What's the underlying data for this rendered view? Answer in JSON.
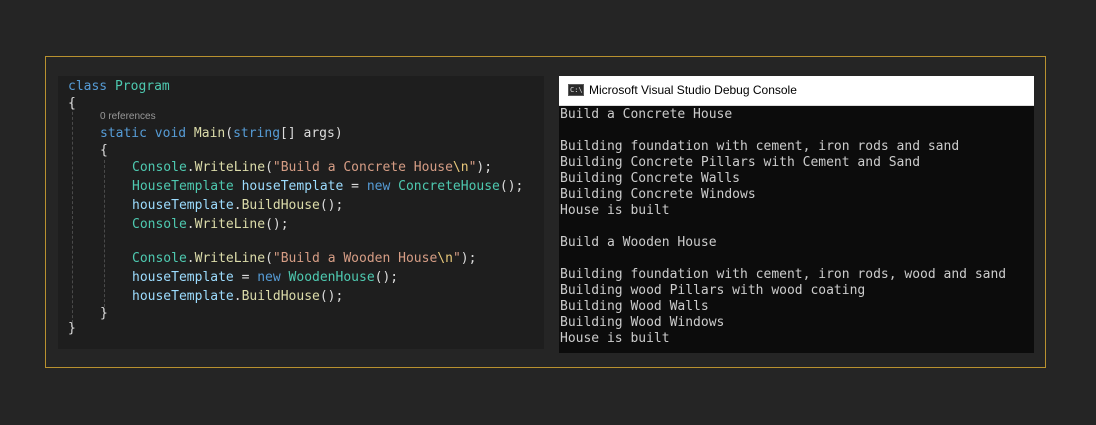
{
  "editor": {
    "codelens": "0 references",
    "tokens": {
      "class_kw": "class",
      "program": "Program",
      "open_brace": "{",
      "close_brace": "}",
      "static_void": "static void",
      "main": "Main",
      "paren_open": "(",
      "string_kw": "string",
      "args_sig": "[] args",
      "paren_close": ")",
      "console": "Console",
      "dot": ".",
      "writeline": "WriteLine",
      "str1": "\"Build a Concrete House",
      "str2": "\"Build a Wooden House",
      "newline_esc": "\\n",
      "quote": "\"",
      "call_end": ");",
      "empty_call": "();",
      "house_template_type": "HouseTemplate",
      "house_template_var": "houseTemplate",
      "assign": " = ",
      "new_kw": "new",
      "concrete_house": "ConcreteHouse",
      "wooden_house": "WoodenHouse",
      "build_house": "BuildHouse"
    }
  },
  "console": {
    "title": "Microsoft Visual Studio Debug Console",
    "icon": "console-app-icon",
    "icon_text": "C:\\",
    "lines": [
      "Build a Concrete House",
      "",
      "Building foundation with cement, iron rods and sand",
      "Building Concrete Pillars with Cement and Sand",
      "Building Concrete Walls",
      "Building Concrete Windows",
      "House is built",
      "",
      "Build a Wooden House",
      "",
      "Building foundation with cement, iron rods, wood and sand",
      "Building wood Pillars with wood coating",
      "Building Wood Walls",
      "Building Wood Windows",
      "House is built"
    ]
  },
  "colors": {
    "frame_border": "#b8912f",
    "keyword": "#569cd6",
    "type": "#4ec9b0",
    "method": "#dcdcaa",
    "string": "#d69d85",
    "variable": "#9cdcfe"
  }
}
